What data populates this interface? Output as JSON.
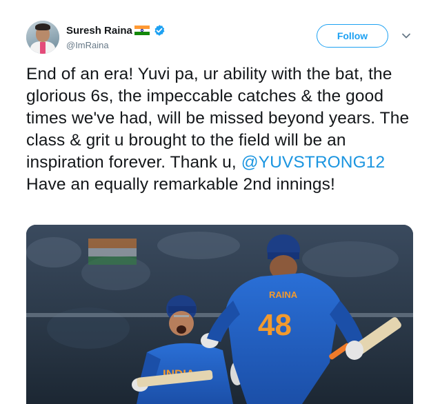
{
  "author": {
    "display_name": "Suresh Raina",
    "handle": "@ImRaina",
    "verified": true,
    "badge_icon": "india-flag-icon"
  },
  "actions": {
    "follow_label": "Follow",
    "menu_icon": "chevron-down-icon"
  },
  "tweet": {
    "text_before": "End of an era! Yuvi pa, ur ability with the bat, the glorious 6s, the impeccable catches & the good times we've had, will be missed beyond years. The class & grit u brought to the field will be an inspiration forever. Thank u, ",
    "mention": "@YUVSTRONG12",
    "text_after": " Have an equally remarkable 2nd innings!"
  },
  "media": {
    "jersey_name": "RAINA",
    "jersey_number": "48",
    "shirt_text": "INDIA"
  },
  "colors": {
    "accent": "#1da1f2",
    "mention": "#1b95e0",
    "secondary_text": "#657786"
  }
}
